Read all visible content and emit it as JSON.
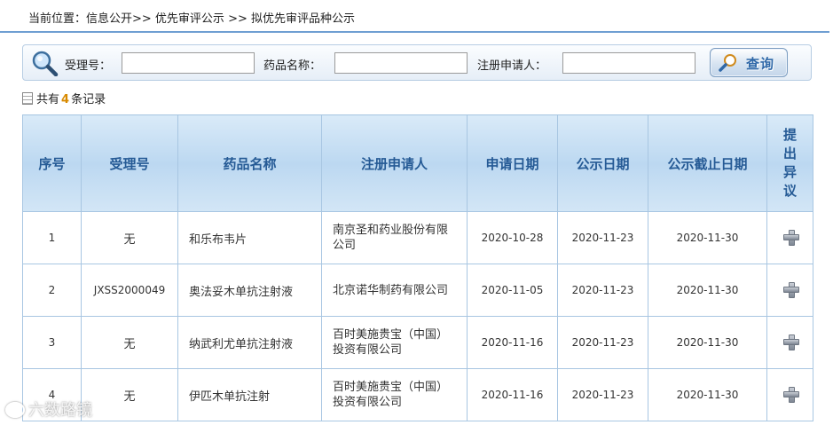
{
  "breadcrumb": {
    "prefix": "当前位置：",
    "path": "信息公开>> 优先审评公示 >> 拟优先审评品种公示"
  },
  "search": {
    "accept_no_label": "受理号：",
    "accept_no_value": "",
    "drug_name_label": "药品名称：",
    "drug_name_value": "",
    "applicant_label": "注册申请人：",
    "applicant_value": "",
    "query_button": "查询",
    "search_icon": "magnifier-icon"
  },
  "summary": {
    "prefix": "共有",
    "count": "4",
    "suffix": "条记录"
  },
  "table": {
    "headers": [
      "序号",
      "受理号",
      "药品名称",
      "注册申请人",
      "申请日期",
      "公示日期",
      "公示截止日期",
      "提出异议"
    ],
    "objection_header_lines": [
      "提",
      "出",
      "异",
      "议"
    ],
    "rows": [
      {
        "no": "1",
        "accept_no": "无",
        "drug": "和乐布韦片",
        "applicant": "南京圣和药业股份有限公司",
        "apply_date": "2020-10-28",
        "publish_date": "2020-11-23",
        "deadline": "2020-11-30",
        "action_icon": "plus-icon"
      },
      {
        "no": "2",
        "accept_no": "JXSS2000049",
        "drug": "奥法妥木单抗注射液",
        "applicant": "北京诺华制药有限公司",
        "apply_date": "2020-11-05",
        "publish_date": "2020-11-23",
        "deadline": "2020-11-30",
        "action_icon": "plus-icon"
      },
      {
        "no": "3",
        "accept_no": "无",
        "drug": "纳武利尤单抗注射液",
        "applicant": "百时美施贵宝（中国）投资有限公司",
        "apply_date": "2020-11-16",
        "publish_date": "2020-11-23",
        "deadline": "2020-11-30",
        "action_icon": "plus-icon"
      },
      {
        "no": "4",
        "accept_no": "无",
        "drug": "伊匹木单抗注射",
        "applicant": "百时美施贵宝（中国）投资有限公司",
        "apply_date": "2020-11-16",
        "publish_date": "2020-11-23",
        "deadline": "2020-11-30",
        "action_icon": "plus-icon"
      }
    ]
  },
  "watermark": "六数路镜",
  "colors": {
    "header_text": "#255a95",
    "header_bg": "#bcd8f1",
    "border": "#a8c6e2",
    "count_highlight": "#d88a00",
    "breadcrumb_rule": "#6f9fd2"
  }
}
